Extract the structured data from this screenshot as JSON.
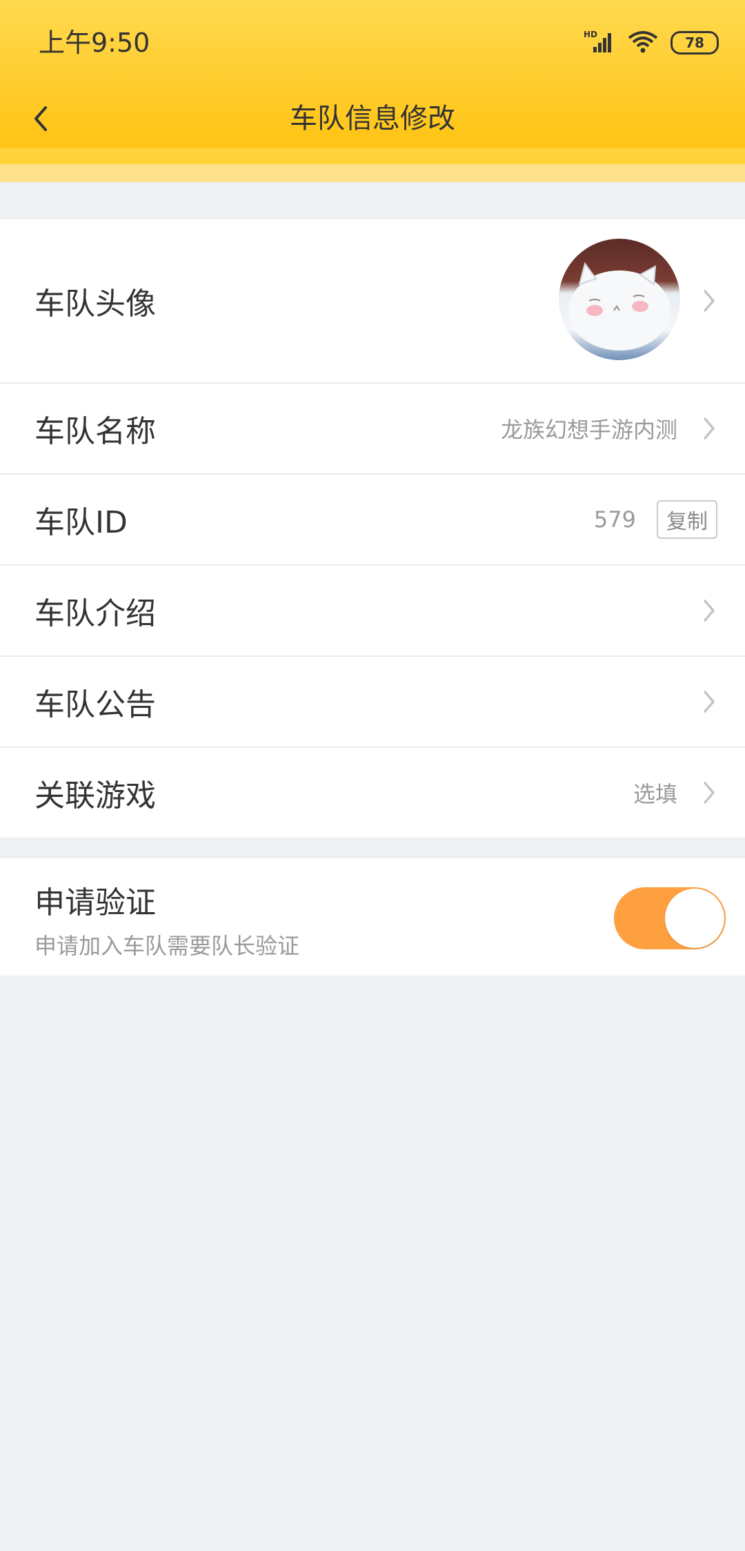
{
  "status_bar": {
    "time": "上午9:50",
    "network_label": "HD",
    "battery_level": "78",
    "icons": [
      "signal-icon",
      "wifi-icon",
      "battery-icon"
    ]
  },
  "nav": {
    "back_icon": "chevron-left-icon",
    "title": "车队信息修改"
  },
  "rows": {
    "avatar": {
      "label": "车队头像"
    },
    "name": {
      "label": "车队名称",
      "value": "龙族幻想手游内测"
    },
    "id": {
      "label": "车队ID",
      "value": "579",
      "copy_label": "复制"
    },
    "intro": {
      "label": "车队介绍"
    },
    "notice": {
      "label": "车队公告"
    },
    "game": {
      "label": "关联游戏",
      "value": "选填"
    }
  },
  "verify": {
    "title": "申请验证",
    "subtitle": "申请加入车队需要队长验证",
    "enabled": true
  },
  "colors": {
    "header_top": "#ffd94f",
    "header_bottom": "#ffc414",
    "toggle_on": "#ffa040",
    "page_background": "#eff0f2"
  }
}
